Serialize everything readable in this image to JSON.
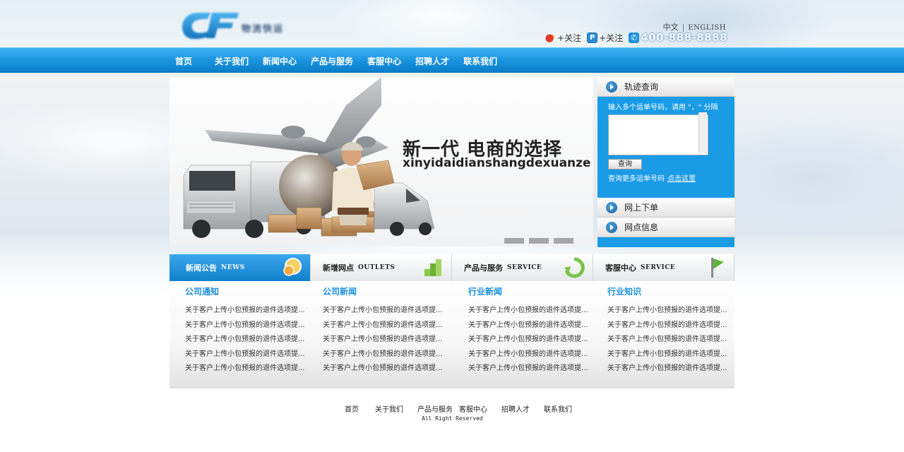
{
  "header": {
    "logo_text": "物流快运",
    "lang_cn": "中文",
    "lang_sep": "|",
    "lang_en": "ENGLISH",
    "weibo_follow": "+关注",
    "tqq_follow": "+关注",
    "phone": "400-888-8888"
  },
  "nav": {
    "items": [
      "首页",
      "关于我们",
      "新闻中心",
      "产品与服务",
      "客服中心",
      "招聘人才",
      "联系我们"
    ]
  },
  "banner": {
    "slogan": "新一代 电商的选择",
    "slogan_pinyin": "xinyidaidianshangdexuanze"
  },
  "side": {
    "track_title": "轨迹查询",
    "track_hint": "输入多个运单号码，请用 \"，\" 分隔",
    "track_button": "查询",
    "track_more": "查询更多运单号码",
    "track_more_link": "点击这里",
    "order_title": "网上下单",
    "outlet_title": "网点信息"
  },
  "tabs": [
    {
      "cn": "新闻公告",
      "en": "NEWS"
    },
    {
      "cn": "新增网点",
      "en": "OUTLETS"
    },
    {
      "cn": "产品与服务",
      "en": "SERVICE"
    },
    {
      "cn": "客服中心",
      "en": "SERVICE"
    }
  ],
  "columns": [
    {
      "title": "公司通知",
      "items": [
        "关于客户上传小包预报的退件选项提...",
        "关于客户上传小包预报的退件选项提...",
        "关于客户上传小包预报的退件选项提...",
        "关于客户上传小包预报的退件选项提...",
        "关于客户上传小包预报的退件选项提..."
      ]
    },
    {
      "title": "公司新闻",
      "items": [
        "关于客户上传小包预报的退件选项提...",
        "关于客户上传小包预报的退件选项提...",
        "关于客户上传小包预报的退件选项提...",
        "关于客户上传小包预报的退件选项提...",
        "关于客户上传小包预报的退件选项提..."
      ]
    },
    {
      "title": "行业新闻",
      "items": [
        "关于客户上传小包预报的退件选项提...",
        "关于客户上传小包预报的退件选项提...",
        "关于客户上传小包预报的退件选项提...",
        "关于客户上传小包预报的退件选项提...",
        "关于客户上传小包预报的退件选项提..."
      ]
    },
    {
      "title": "行业知识",
      "items": [
        "关于客户上传小包预报的退件选项提...",
        "关于客户上传小包预报的退件选项提...",
        "关于客户上传小包预报的退件选项提...",
        "关于客户上传小包预报的退件选项提...",
        "关于客户上传小包预报的退件选项提..."
      ]
    }
  ],
  "footer": {
    "links": [
      "首页",
      "关于我们",
      "产品与服务",
      "客服中心",
      "招聘人才",
      "联系我们"
    ],
    "copyright": "All Right Reserved"
  },
  "colors": {
    "nav_blue": "#1c95e0",
    "panel_blue": "#1a9be6",
    "heading_blue": "#1a8fdc"
  }
}
